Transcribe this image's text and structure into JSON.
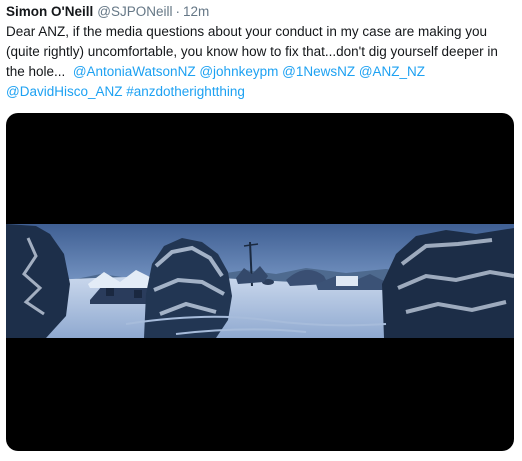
{
  "tweet": {
    "author_name": "Simon O'Neill",
    "author_handle": "@SJPONeill",
    "separator": "·",
    "timestamp": "12m",
    "text": "Dear ANZ, if the media questions about your conduct in my case are making you (quite rightly) uncomfortable, you know how to fix that...don't dig yourself deeper in the hole...",
    "mentions": [
      "@AntoniaWatsonNZ",
      "@johnkeypm",
      "@1NewsNZ",
      "@ANZ_NZ",
      "@DavidHisco_ANZ"
    ],
    "hashtag": "#anzdotherightthing"
  },
  "colors": {
    "link": "#1da1f2",
    "secondary_text": "#657786",
    "primary_text": "#14171a",
    "media_background": "#000000"
  }
}
